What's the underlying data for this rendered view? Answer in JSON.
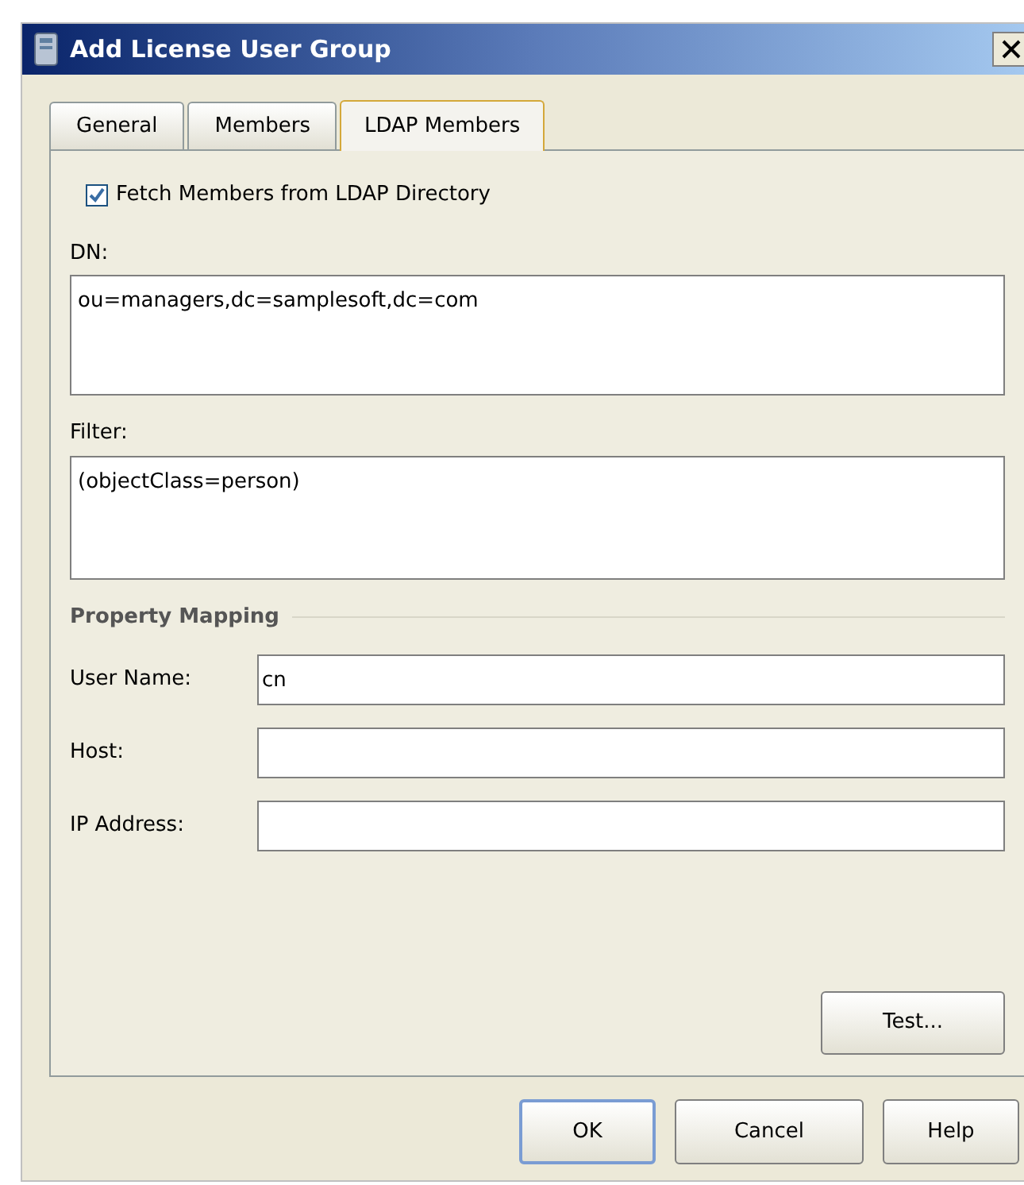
{
  "window": {
    "title": "Add License User Group"
  },
  "tabs": [
    {
      "label": "General",
      "selected": false
    },
    {
      "label": "Members",
      "selected": false
    },
    {
      "label": "LDAP Members",
      "selected": true
    }
  ],
  "fetch_checkbox": {
    "label": "Fetch Members from LDAP Directory",
    "checked": true
  },
  "dn": {
    "label": "DN:",
    "value": "ou=managers,dc=samplesoft,dc=com"
  },
  "filter": {
    "label": "Filter:",
    "value": "(objectClass=person)"
  },
  "property_mapping": {
    "title": "Property Mapping",
    "fields": [
      {
        "label": "User Name:",
        "value": "cn"
      },
      {
        "label": "Host:"
      },
      {
        "label": "IP Address:"
      }
    ]
  },
  "test_button": "Test...",
  "buttons": [
    {
      "label": "OK",
      "default": true
    },
    {
      "label": "Cancel",
      "default": false
    },
    {
      "label": "Help",
      "default": false
    }
  ]
}
